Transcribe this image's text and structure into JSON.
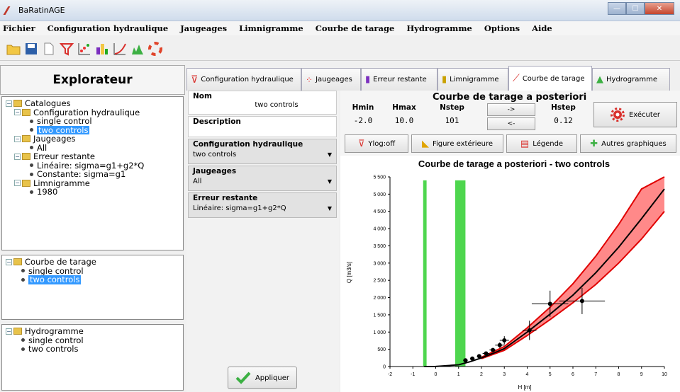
{
  "window": {
    "title": "BaRatinAGE",
    "minimize": "—",
    "maximize": "☐",
    "close": "✕"
  },
  "menu": [
    "Fichier",
    "Configuration hydraulique",
    "Jaugeages",
    "Limnigramme",
    "Courbe de tarage",
    "Hydrogramme",
    "Options",
    "Aide"
  ],
  "explorer": {
    "title": "Explorateur",
    "catalogues": "Catalogues",
    "config_hyd": "Configuration hydraulique",
    "single_control": "single control",
    "two_controls": "two controls",
    "jaugeages": "Jaugeages",
    "all": "All",
    "erreur": "Erreur restante",
    "lineaire": "Linéaire: sigma=g1+g2*Q",
    "constante": "Constante: sigma=g1",
    "limnigramme": "Limnigramme",
    "year": "1980",
    "courbe": "Courbe de tarage",
    "courbe_single": "single control",
    "courbe_two": "two controls",
    "hydro": "Hydrogramme",
    "hydro_single": "single control",
    "hydro_two": "two controls"
  },
  "tabs": [
    "Configuration hydraulique",
    "Jaugeages",
    "Erreur restante",
    "Limnigramme",
    "Courbe de tarage",
    "Hydrogramme"
  ],
  "form": {
    "nom_label": "Nom",
    "nom_value": "two controls",
    "desc_label": "Description",
    "config_label": "Configuration hydraulique",
    "config_value": "two controls",
    "jaug_label": "Jaugeages",
    "jaug_value": "All",
    "err_label": "Erreur restante",
    "err_value": "Linéaire: sigma=g1+g2*Q",
    "apply": "Appliquer"
  },
  "params": {
    "title": "Courbe de tarage a posteriori",
    "hmin_label": "Hmin",
    "hmin": "-2.0",
    "hmax_label": "Hmax",
    "hmax": "10.0",
    "nstep_label": "Nstep",
    "nstep": "101",
    "hstep_label": "Hstep",
    "hstep": "0.12",
    "right_arrow": "->",
    "left_arrow": "<-",
    "execute": "Exécuter"
  },
  "graph_buttons": {
    "ylog": "Ylog:off",
    "figure": "Figure extérieure",
    "legend": "Légende",
    "other": "Autres graphiques"
  },
  "colors": {
    "accent": "#3399ff",
    "envelope": "#ff3b3b",
    "stage_bands": "#22cc22"
  },
  "chart_data": {
    "type": "line",
    "title": "Courbe de tarage a posteriori - two controls",
    "xlabel": "H [m]",
    "ylabel": "Q [m3/s]",
    "xlim": [
      -2,
      10
    ],
    "ylim": [
      0,
      5500
    ],
    "x_ticks": [
      -2,
      -1,
      0,
      1,
      2,
      3,
      4,
      5,
      6,
      7,
      8,
      9,
      10
    ],
    "y_ticks": [
      0,
      500,
      1000,
      1500,
      2000,
      2500,
      3000,
      3500,
      4000,
      4500,
      5000,
      5500
    ],
    "y_tick_labels": [
      "0",
      "500",
      "1 000",
      "1 500",
      "2 000",
      "2 500",
      "3 000",
      "3 500",
      "4 000",
      "4 500",
      "5 000",
      "5 500"
    ],
    "grid": false,
    "series": [
      {
        "kind": "median",
        "x": [
          -0.5,
          0,
          1,
          1.5,
          2,
          2.5,
          3,
          4,
          5,
          6,
          7,
          8,
          9,
          10
        ],
        "y": [
          0,
          2,
          50,
          140,
          250,
          380,
          520,
          1000,
          1520,
          2070,
          2720,
          3460,
          4290,
          5150
        ]
      },
      {
        "kind": "upper",
        "x": [
          2,
          3,
          4,
          5,
          6,
          7,
          8,
          9,
          10
        ],
        "y": [
          270,
          580,
          1120,
          1720,
          2400,
          3200,
          4120,
          5150,
          6300
        ]
      },
      {
        "kind": "lower",
        "x": [
          2,
          3,
          4,
          5,
          6,
          7,
          8,
          9,
          10
        ],
        "y": [
          230,
          470,
          900,
          1360,
          1850,
          2380,
          3000,
          3700,
          4500
        ]
      }
    ],
    "gaugings": [
      {
        "x": 1.3,
        "y": 180,
        "ex": 0.1,
        "ey": 30
      },
      {
        "x": 1.6,
        "y": 230,
        "ex": 0.1,
        "ey": 30
      },
      {
        "x": 1.9,
        "y": 300,
        "ex": 0.1,
        "ey": 40
      },
      {
        "x": 2.2,
        "y": 380,
        "ex": 0.15,
        "ey": 50
      },
      {
        "x": 2.5,
        "y": 480,
        "ex": 0.15,
        "ey": 60
      },
      {
        "x": 2.8,
        "y": 620,
        "ex": 0.2,
        "ey": 80
      },
      {
        "x": 3.0,
        "y": 760,
        "ex": 0.2,
        "ey": 120
      },
      {
        "x": 4.1,
        "y": 1050,
        "ex": 0.3,
        "ey": 280
      },
      {
        "x": 5.0,
        "y": 1820,
        "ex": 0.8,
        "ey": 380
      },
      {
        "x": 6.4,
        "y": 1900,
        "ex": 1.0,
        "ey": 380
      }
    ],
    "stage_bands": [
      {
        "from": -0.55,
        "to": -0.4,
        "top": 5400
      },
      {
        "from": 0.85,
        "to": 1.3,
        "top": 5400
      }
    ]
  }
}
